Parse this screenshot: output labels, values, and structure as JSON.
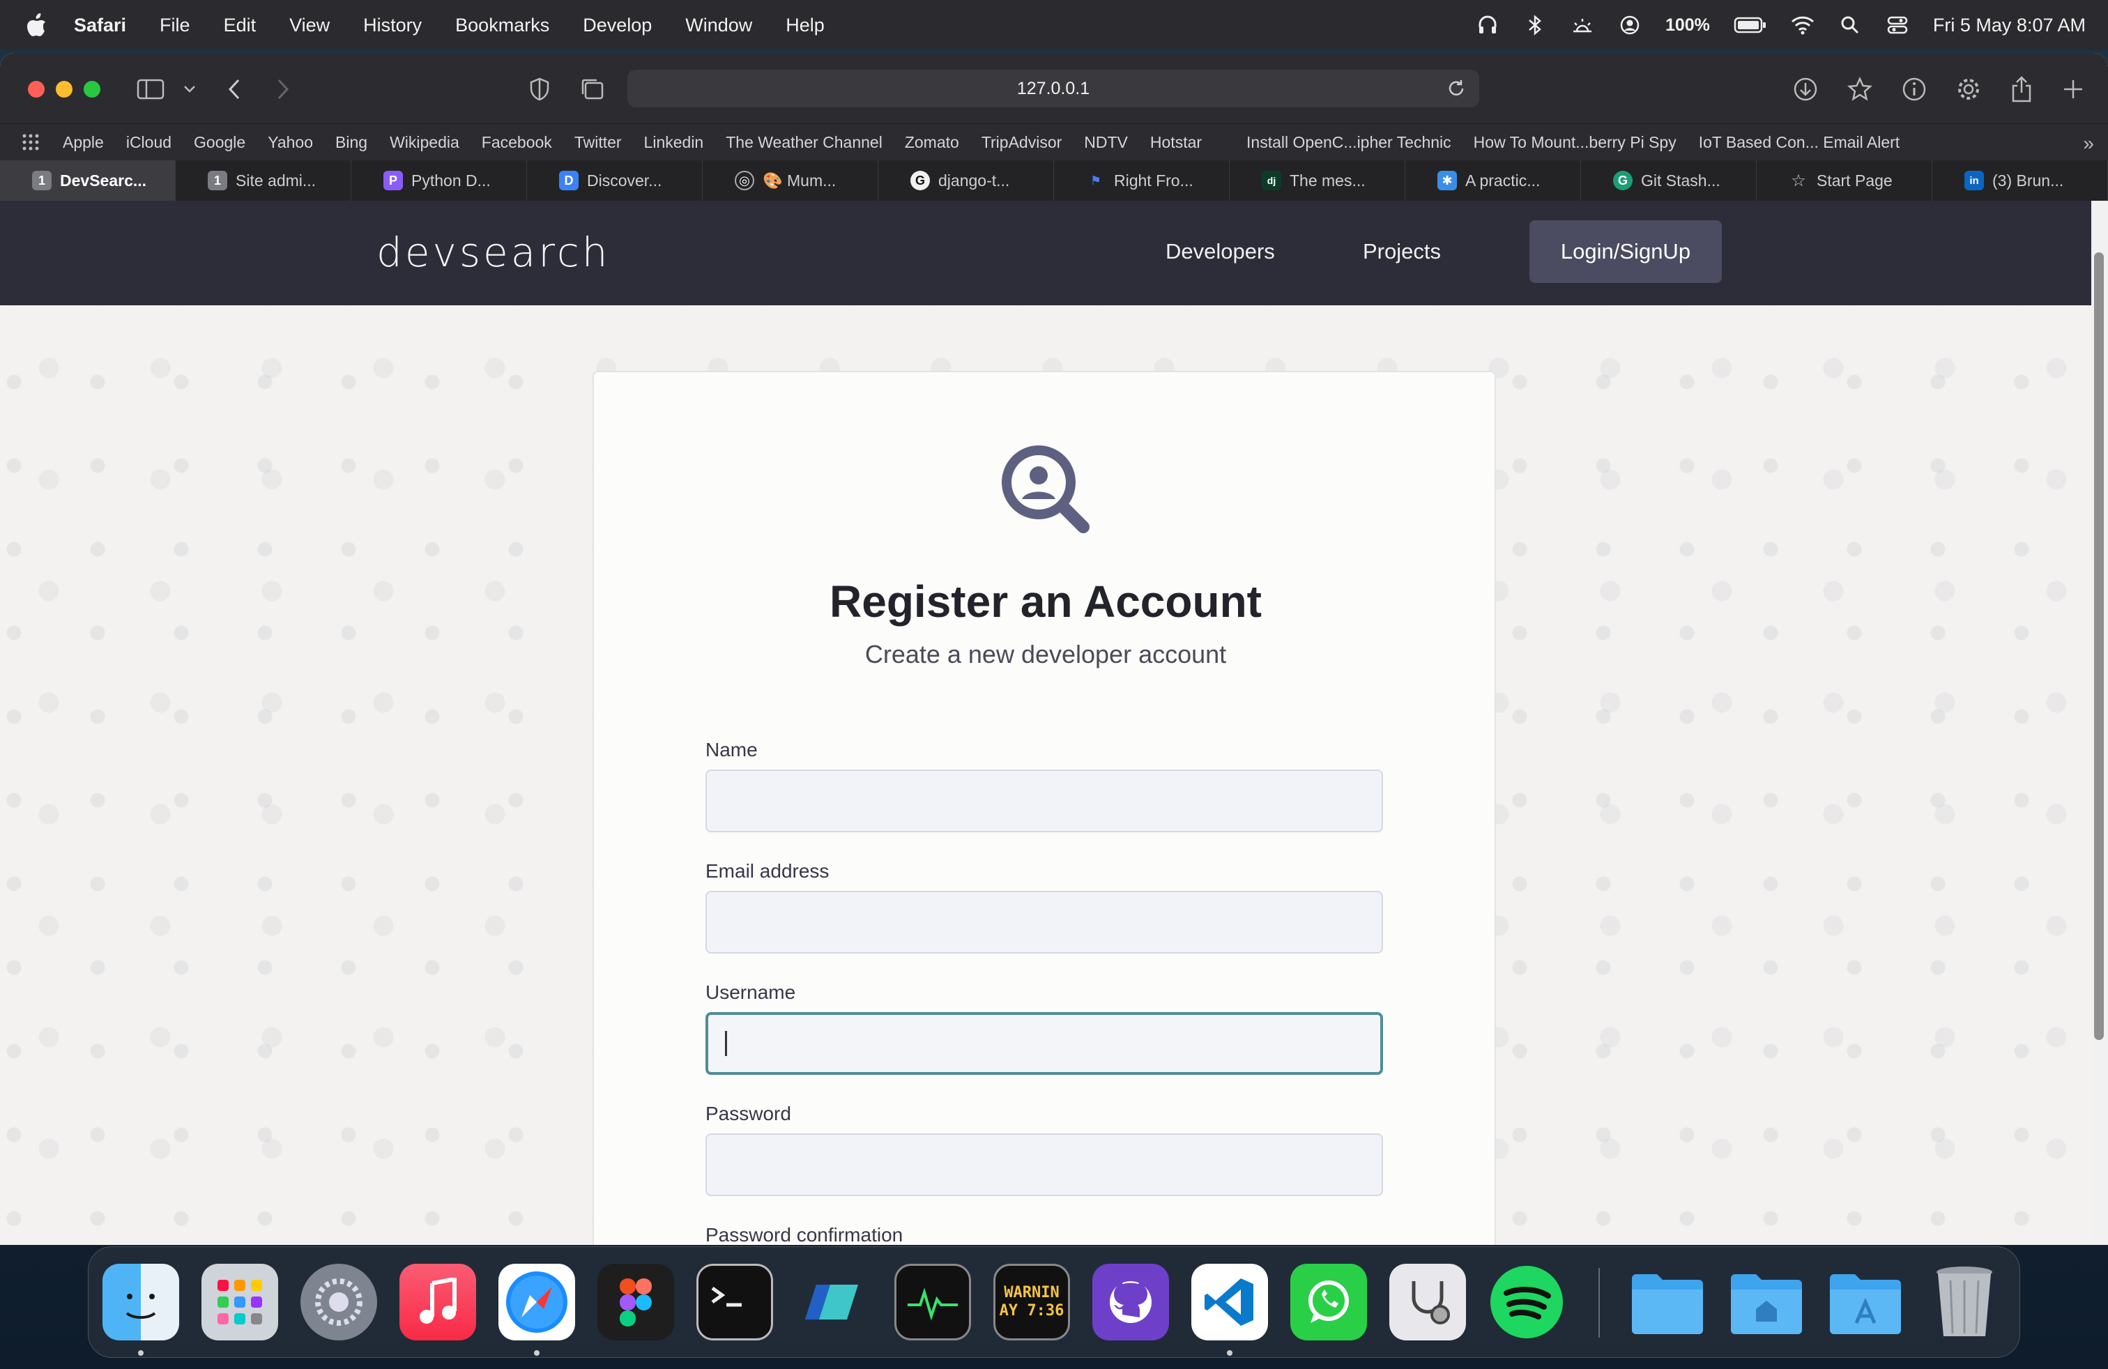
{
  "menubar": {
    "app_name": "Safari",
    "items": [
      "File",
      "Edit",
      "View",
      "History",
      "Bookmarks",
      "Develop",
      "Window",
      "Help"
    ],
    "battery": "100%",
    "datetime": "Fri 5 May  8:07 AM"
  },
  "browser": {
    "url": "127.0.0.1",
    "favorites": [
      "Apple",
      "iCloud",
      "Google",
      "Yahoo",
      "Bing",
      "Wikipedia",
      "Facebook",
      "Twitter",
      "Linkedin",
      "The Weather Channel",
      "Zomato",
      "TripAdvisor",
      "NDTV",
      "Hotstar",
      "Install OpenC...ipher Technic",
      "How To Mount...berry Pi Spy",
      "IoT Based Con... Email Alert"
    ],
    "tabs": [
      {
        "label": "DevSearc...",
        "active": true,
        "icon": "1"
      },
      {
        "label": "Site admi...",
        "active": false,
        "icon": "1"
      },
      {
        "label": "Python D...",
        "active": false,
        "icon": "P"
      },
      {
        "label": "Discover...",
        "active": false,
        "icon": "D"
      },
      {
        "label": "🎨 Mum...",
        "active": false,
        "icon": "◎"
      },
      {
        "label": "django-t...",
        "active": false,
        "icon": "G"
      },
      {
        "label": "Right Fro...",
        "active": false,
        "icon": "⚑"
      },
      {
        "label": "The mes...",
        "active": false,
        "icon": "dj"
      },
      {
        "label": "A practic...",
        "active": false,
        "icon": "✱"
      },
      {
        "label": "Git Stash...",
        "active": false,
        "icon": "G"
      },
      {
        "label": "Start Page",
        "active": false,
        "icon": "☆"
      },
      {
        "label": "(3) Brun...",
        "active": false,
        "icon": "in"
      }
    ]
  },
  "site": {
    "logo": "devsearch",
    "nav": {
      "developers": "Developers",
      "projects": "Projects",
      "login": "Login/SignUp"
    }
  },
  "form": {
    "title": "Register an Account",
    "subtitle": "Create a new developer account",
    "fields": [
      {
        "label": "Name",
        "value": ""
      },
      {
        "label": "Email address",
        "value": ""
      },
      {
        "label": "Username",
        "value": "",
        "focused": true
      },
      {
        "label": "Password",
        "value": ""
      },
      {
        "label": "Password confirmation",
        "value": ""
      }
    ]
  },
  "dock": {
    "apps": [
      "Finder",
      "Launchpad",
      "System Settings",
      "Music",
      "Safari",
      "Figma",
      "Terminal",
      "Sidekick",
      "Activity Monitor",
      "Console",
      "GitHub Desktop",
      "Visual Studio Code",
      "WhatsApp",
      "Disk Utility",
      "Spotify",
      "Downloads",
      "Home",
      "Applications",
      "Trash"
    ],
    "console_text": "WARNIN\nAY 7:36"
  },
  "colors": {
    "header_bg": "#2d2d39",
    "login_btn": "#4b4b61",
    "focus_border": "#4f8e96",
    "icon_color": "#5e6081"
  }
}
